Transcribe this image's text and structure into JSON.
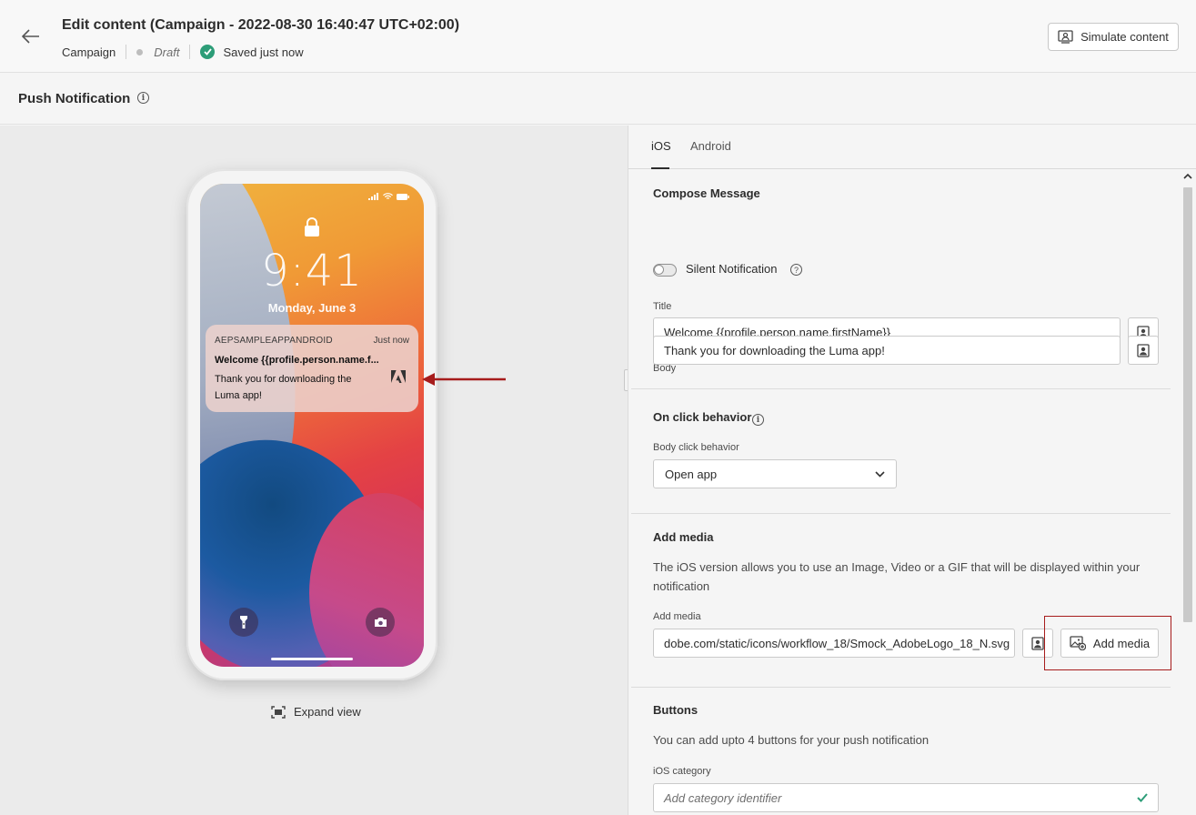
{
  "header": {
    "title": "Edit content (Campaign - 2022-08-30 16:40:47 UTC+02:00)",
    "breadcrumb": "Campaign",
    "status": "Draft",
    "saved": "Saved just now",
    "simulate_label": "Simulate content"
  },
  "subheader": {
    "title": "Push Notification"
  },
  "preview": {
    "time": "9:41",
    "date": "Monday, June 3",
    "notification": {
      "app_name": "AEPSAMPLEAPPANDROID",
      "timestamp": "Just now",
      "title": "Welcome {{profile.person.name.f...",
      "body": "Thank you for downloading the Luma app!"
    },
    "expand_label": "Expand view",
    "arrow_color": "#a61c1c"
  },
  "tabs": [
    {
      "label": "iOS",
      "active": true
    },
    {
      "label": "Android",
      "active": false
    }
  ],
  "compose": {
    "title": "Compose Message",
    "silent_label": "Silent Notification",
    "silent_on": false,
    "title_label": "Title",
    "title_value": "Welcome {{profile.person.name.firstName}}",
    "body_label": "Body",
    "body_value": "Thank you for downloading the Luma app!"
  },
  "click_behavior": {
    "title": "On click behavior",
    "label": "Body click behavior",
    "value": "Open app"
  },
  "media": {
    "title": "Add media",
    "description": "The iOS version allows you to use an Image, Video or a GIF that will be displayed within your notification",
    "label": "Add media",
    "value": "dobe.com/static/icons/workflow_18/Smock_AdobeLogo_18_N.svg",
    "button_label": "Add media",
    "highlight_color": "#a61c1c"
  },
  "buttons": {
    "title": "Buttons",
    "description": "You can add upto 4 buttons for your push notification",
    "category_label": "iOS category",
    "category_placeholder": "Add category identifier"
  },
  "colors": {
    "success": "#2d9d78",
    "highlight": "#a61c1c"
  }
}
